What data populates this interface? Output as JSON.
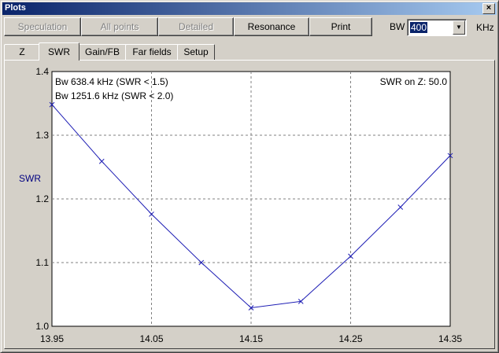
{
  "window": {
    "title": "Plots",
    "close_glyph": "×"
  },
  "toolbar": {
    "speculation": "Speculation",
    "all_points": "All points",
    "detailed": "Detailed",
    "resonance": "Resonance",
    "print": "Print",
    "bw_label": "BW",
    "bw_value": "400",
    "khz_label": "KHz"
  },
  "tabs": [
    "Z",
    "SWR",
    "Gain/FB",
    "Far fields",
    "Setup"
  ],
  "active_tab": "SWR",
  "chart_data": {
    "type": "line",
    "ylabel": "SWR",
    "xlim": [
      13.95,
      14.35
    ],
    "ylim": [
      1.0,
      1.4
    ],
    "x_ticks": [
      "13.95",
      "14.05",
      "14.15",
      "14.25",
      "14.35"
    ],
    "y_ticks": [
      "1.0",
      "1.1",
      "1.2",
      "1.3",
      "1.4"
    ],
    "grid": true,
    "annotations": {
      "bw1": "Bw 638.4 kHz (SWR < 1.5)",
      "bw2": "Bw 1251.6 kHz (SWR < 2.0)",
      "ref": "SWR on Z: 50.0"
    },
    "line_color": "#1c1cb4",
    "series": [
      {
        "x": [
          13.95,
          14.0,
          14.05,
          14.1,
          14.15,
          14.2,
          14.25,
          14.3,
          14.35
        ],
        "y": [
          1.348,
          1.259,
          1.176,
          1.1,
          1.029,
          1.039,
          1.11,
          1.187,
          1.268
        ]
      }
    ]
  }
}
